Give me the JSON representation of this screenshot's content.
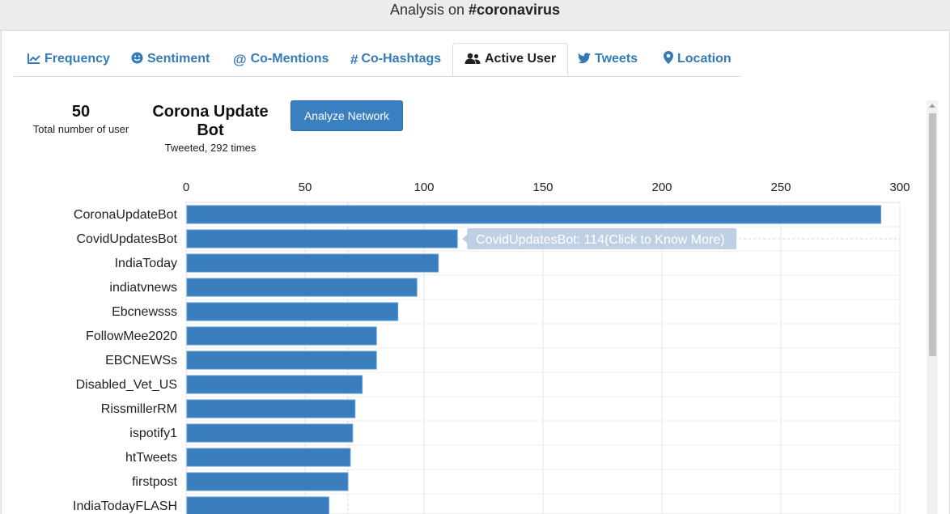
{
  "header": {
    "prefix": "Analysis on",
    "hashtag": "#coronavirus"
  },
  "tabs": [
    {
      "label": "Frequency",
      "icon": "line-chart-icon",
      "active": false
    },
    {
      "label": "Sentiment",
      "icon": "smile-icon",
      "active": false
    },
    {
      "label": "Co-Mentions",
      "icon": "at-icon",
      "active": false
    },
    {
      "label": "Co-Hashtags",
      "icon": "hashtag-icon",
      "active": false
    },
    {
      "label": "Active User",
      "icon": "users-icon",
      "active": true
    },
    {
      "label": "Tweets",
      "icon": "twitter-icon",
      "active": false
    },
    {
      "label": "Location",
      "icon": "map-marker-icon",
      "active": false
    }
  ],
  "stats": {
    "total_users": "50",
    "total_users_label": "Total number of user",
    "top_user": "Corona Update Bot",
    "top_user_label": "Tweeted, 292 times"
  },
  "analyze_button": "Analyze Network",
  "tooltip": "CovidUpdatesBot: 114(Click to Know More)",
  "colors": {
    "bar": "#3a7dbd",
    "accent": "#337ab7",
    "button": "#3a7fbf"
  },
  "chart_data": {
    "type": "bar",
    "orientation": "horizontal",
    "axis_position": "top",
    "categories": [
      "CoronaUpdateBot",
      "CovidUpdatesBot",
      "IndiaToday",
      "indiatvnews",
      "Ebcnewsss",
      "FollowMee2020",
      "EBCNEWSs",
      "Disabled_Vet_US",
      "RissmillerRM",
      "ispotify1",
      "htTweets",
      "firstpost",
      "IndiaTodayFLASH"
    ],
    "values": [
      292,
      114,
      106,
      97,
      89,
      80,
      80,
      74,
      71,
      70,
      69,
      68,
      60
    ],
    "xlim": [
      0,
      300
    ],
    "xticks": [
      0,
      50,
      100,
      150,
      200,
      250,
      300
    ],
    "grid": true
  }
}
